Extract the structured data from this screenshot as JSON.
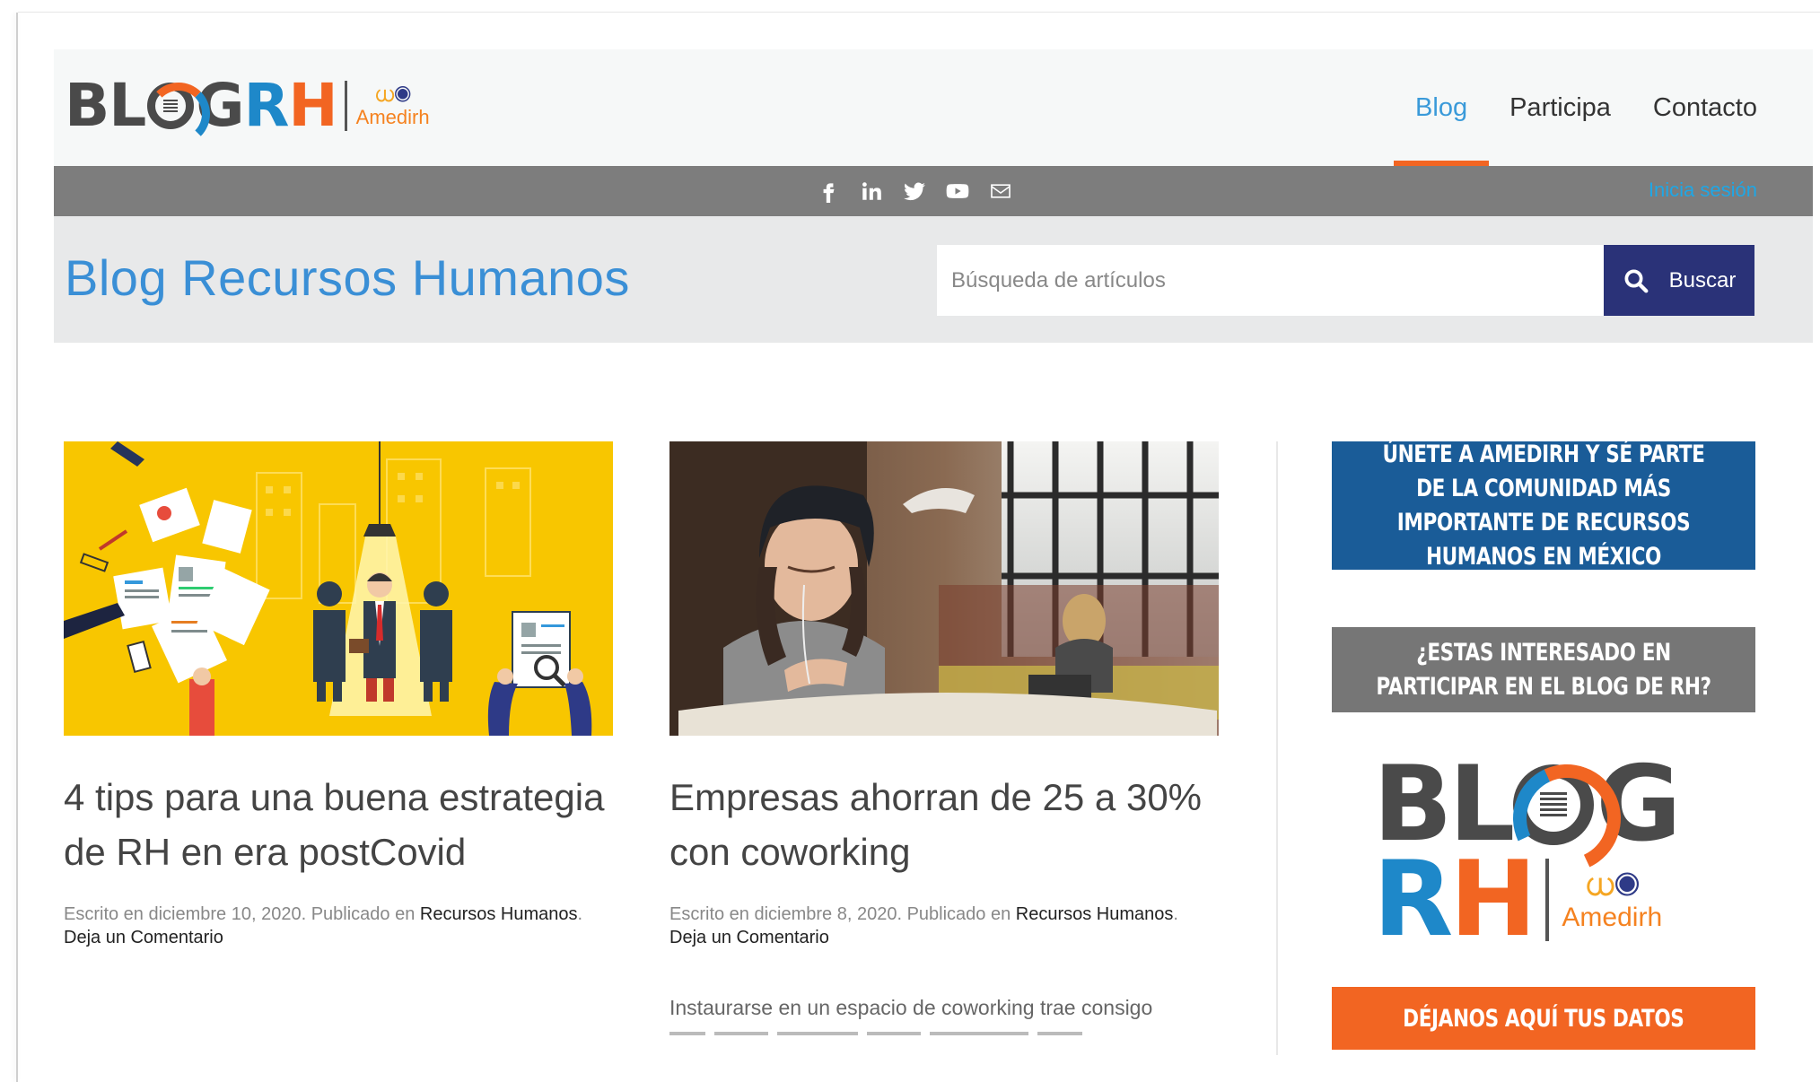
{
  "header": {
    "logo_text": "BLOGRH",
    "logo_org": "Amedirh",
    "nav": [
      {
        "label": "Blog",
        "active": true
      },
      {
        "label": "Participa",
        "active": false
      },
      {
        "label": "Contacto",
        "active": false
      }
    ]
  },
  "social_bar": {
    "icons": [
      "facebook-icon",
      "linkedin-icon",
      "twitter-icon",
      "youtube-icon",
      "mail-icon"
    ],
    "login_label": "Inicia sesión"
  },
  "search": {
    "page_title": "Blog Recursos Humanos",
    "placeholder": "Búsqueda de artículos",
    "button_label": "Buscar"
  },
  "articles": [
    {
      "title": "4 tips para una buena estrategia de RH en era postCovid",
      "meta_prefix": "Escrito en diciembre 10, 2020. Publicado en ",
      "category": "Recursos Humanos",
      "meta_suffix": ".",
      "comment_label": "Deja un Comentario",
      "excerpt": ""
    },
    {
      "title": "Empresas ahorran de 25 a 30% con coworking",
      "meta_prefix": "Escrito en diciembre 8, 2020. Publicado en ",
      "category": "Recursos Humanos",
      "meta_suffix": ".",
      "comment_label": "Deja un Comentario",
      "excerpt": "Instaurarse en un espacio de coworking trae consigo"
    }
  ],
  "sidebar": {
    "banner_join": "ÚNETE A AMEDIRH Y SÉ PARTE DE LA COMUNIDAD MÁS IMPORTANTE DE RECURSOS HUMANOS EN MÉXICO",
    "banner_participate": "¿ESTAS INTERESADO EN PARTICIPAR EN EL BLOG DE RH?",
    "logo_top": "BLOG",
    "logo_bottom": "RH",
    "logo_org": "Amedirh",
    "banner_data": "DÉJANOS AQUÍ TUS DATOS"
  },
  "colors": {
    "accent_blue": "#3a8fd6",
    "nav_active_underline": "#f26522",
    "search_button": "#2a3278",
    "banner_blue": "#1a5c98",
    "banner_gray": "#767676",
    "banner_orange": "#f26522"
  }
}
